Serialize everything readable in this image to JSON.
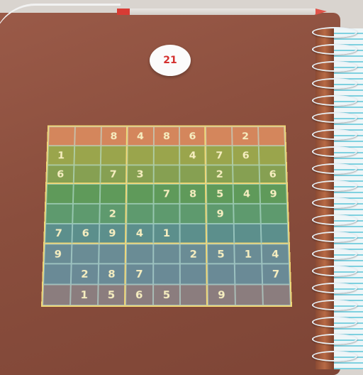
{
  "badge": {
    "number": "21"
  },
  "sudoku": {
    "rows": [
      [
        "",
        "",
        "8",
        "4",
        "8",
        "6",
        "",
        "2",
        ""
      ],
      [
        "1",
        "",
        "",
        "",
        "",
        "4",
        "7",
        "6",
        ""
      ],
      [
        "6",
        "",
        "7",
        "3",
        "",
        "",
        "2",
        "",
        "6"
      ],
      [
        "",
        "",
        "",
        "",
        "7",
        "8",
        "5",
        "4",
        "9"
      ],
      [
        "",
        "",
        "2",
        "",
        "",
        "",
        "9",
        "",
        ""
      ],
      [
        "7",
        "6",
        "9",
        "4",
        "1",
        "",
        "",
        "",
        ""
      ],
      [
        "9",
        "",
        "",
        "",
        "",
        "2",
        "5",
        "1",
        "4"
      ],
      [
        "",
        "2",
        "8",
        "7",
        "",
        "",
        "",
        "",
        "7"
      ],
      [
        "",
        "1",
        "5",
        "6",
        "5",
        "",
        "9",
        "",
        ""
      ]
    ],
    "row_colors": [
      "#d4865c",
      "#9aa54c",
      "#86a052",
      "#5f9a5a",
      "#5e9a6e",
      "#5c8f8c",
      "#6a8c95",
      "#6a8a96",
      "#8b7d7e"
    ]
  }
}
